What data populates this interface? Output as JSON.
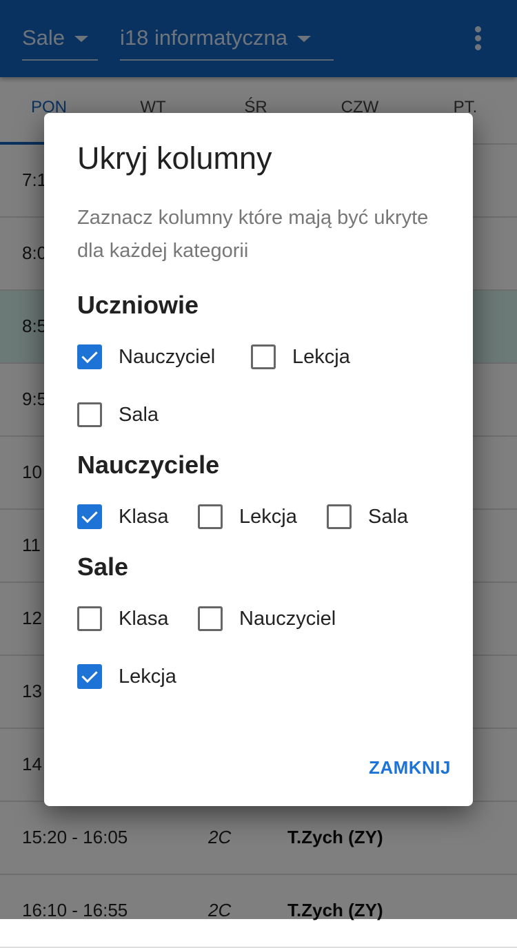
{
  "appbar": {
    "category": "Sale",
    "room": "i18 informatyczna"
  },
  "tabs": [
    "PON",
    "WT",
    "ŚR",
    "CZW",
    "PT."
  ],
  "rows": [
    {
      "time": "7:1",
      "cls": "",
      "name": ""
    },
    {
      "time": "8:0",
      "cls": "",
      "name": ""
    },
    {
      "time": "8:5",
      "cls": "",
      "name": ""
    },
    {
      "time": "9:5",
      "cls": "",
      "name": ""
    },
    {
      "time": "10",
      "cls": "",
      "name": ""
    },
    {
      "time": "11",
      "cls": "",
      "name": ""
    },
    {
      "time": "12",
      "cls": "",
      "name": ""
    },
    {
      "time": "13",
      "cls": "",
      "name": ""
    },
    {
      "time": "14",
      "cls": "",
      "name": ""
    },
    {
      "time": "15:20 - 16:05",
      "cls": "2C",
      "name": "T.Zych (ZY)"
    },
    {
      "time": "16:10 - 16:55",
      "cls": "2C",
      "name": "T.Zych (ZY)"
    }
  ],
  "dialog": {
    "title": "Ukryj kolumny",
    "description": "Zaznacz kolumny które mają być ukryte dla każdej kategorii",
    "sections": [
      {
        "title": "Uczniowie",
        "options": [
          {
            "label": "Nauczyciel",
            "checked": true
          },
          {
            "label": "Lekcja",
            "checked": false
          },
          {
            "label": "Sala",
            "checked": false
          }
        ]
      },
      {
        "title": "Nauczyciele",
        "options": [
          {
            "label": "Klasa",
            "checked": true
          },
          {
            "label": "Lekcja",
            "checked": false
          },
          {
            "label": "Sala",
            "checked": false
          }
        ]
      },
      {
        "title": "Sale",
        "options": [
          {
            "label": "Klasa",
            "checked": false
          },
          {
            "label": "Nauczyciel",
            "checked": false
          },
          {
            "label": "Lekcja",
            "checked": true
          }
        ]
      }
    ],
    "close_label": "ZAMKNIJ"
  }
}
